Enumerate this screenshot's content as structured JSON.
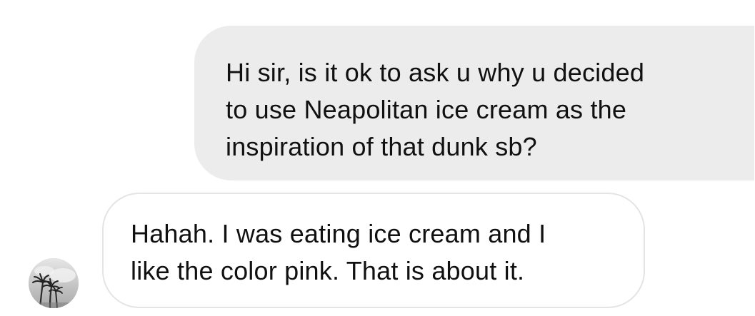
{
  "conversation": {
    "messages": [
      {
        "sender": "me",
        "text": "Hi sir, is it ok to ask u why u decided\nto use Neapolitan ice cream as the\ninspiration of that dunk sb?"
      },
      {
        "sender": "contact",
        "text": "Hahah. I was eating ice cream and I\nlike the color pink. That is about it."
      }
    ]
  },
  "contact": {
    "avatar_icon": "palm-tree-avatar-icon"
  },
  "colors": {
    "sent_bubble": "#ececec",
    "received_bubble": "#ffffff",
    "received_border": "#e4e4e4",
    "text": "#111111"
  }
}
